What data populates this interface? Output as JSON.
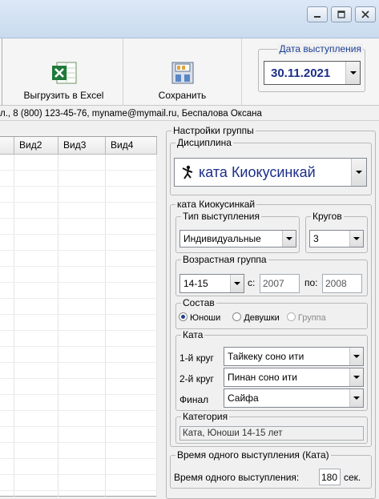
{
  "window": {
    "controls": [
      "minimize",
      "maximize",
      "close"
    ]
  },
  "toolbar": {
    "excel_label": "Выгрузить в Excel",
    "save_label": "Сохранить",
    "date_group_label": "Дата выступления",
    "date_value": "30.11.2021"
  },
  "status": {
    "info_text": "л., 8 (800) 123-45-76, myname@mymail.ru, Беспалова Оксана"
  },
  "grid": {
    "headers": [
      "Вид2",
      "Вид3",
      "Вид4"
    ]
  },
  "settings": {
    "group_title": "Настройки группы",
    "discipline": {
      "label": "Дисциплина",
      "value": "ката Киокусинкай"
    },
    "kata_group": {
      "label": "ката Киокусинкай",
      "performance_type_label": "Тип выступления",
      "performance_type_value": "Индивидуальные",
      "rounds_label": "Кругов",
      "rounds_value": "3",
      "age_group_label": "Возрастная группа",
      "age_group_value": "14-15",
      "from_label": "с:",
      "from_value": "2007",
      "to_label": "по:",
      "to_value": "2008",
      "composition_label": "Состав",
      "composition_options": [
        "Юноши",
        "Девушки",
        "Группа"
      ],
      "composition_selected": "Юноши",
      "kata_label": "Ката",
      "round1_label": "1-й круг",
      "round1_value": "Тайкеку соно ити",
      "round2_label": "2-й круг",
      "round2_value": "Пинан соно ити",
      "final_label": "Финал",
      "final_value": "Сайфа",
      "category_label": "Категория",
      "category_value": "Ката, Юноши 14-15 лет"
    },
    "time_group": {
      "label": "Время одного выступления (Ката)",
      "field_label": "Время одного выступления:",
      "value": "180",
      "unit": "сек."
    }
  }
}
